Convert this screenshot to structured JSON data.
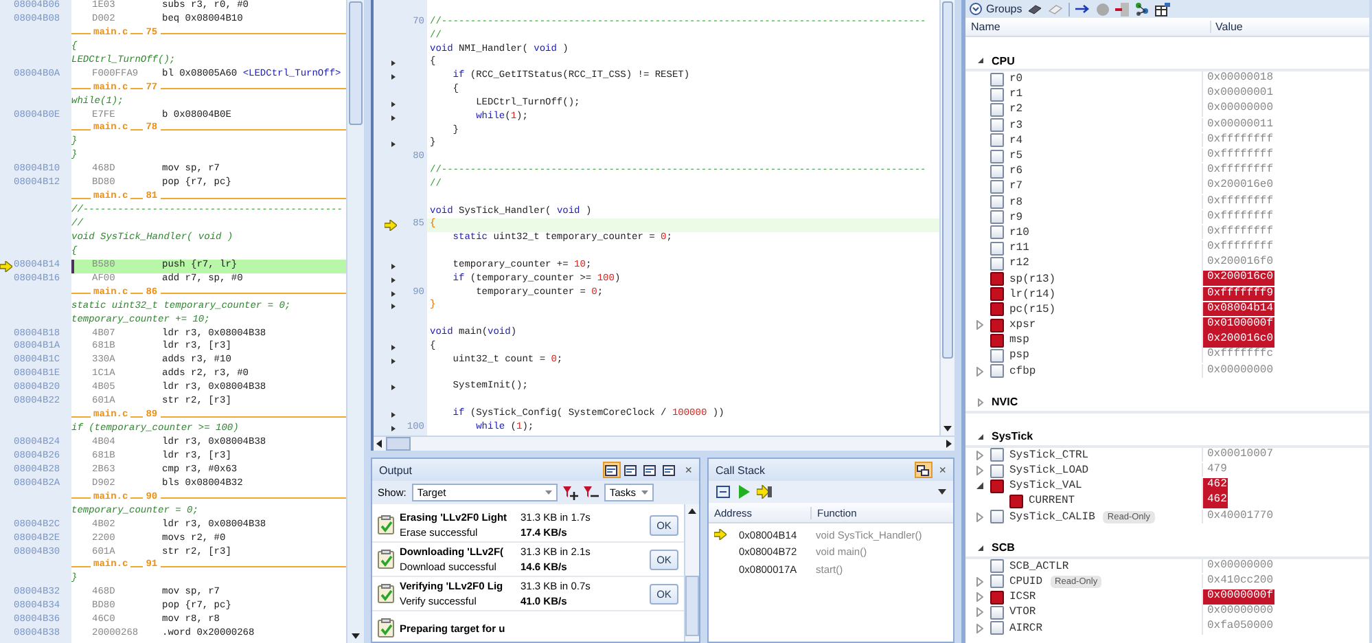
{
  "disassembly": {
    "lines": [
      {
        "kind": "asm",
        "address": "08004B06",
        "opcode": "1E03",
        "instruction": "subs r3, r0, #0",
        "current": false
      },
      {
        "kind": "asm",
        "address": "08004B08",
        "opcode": "D002",
        "instruction": "beq 0x08004B10",
        "current": false
      },
      {
        "kind": "file",
        "file": "main.c",
        "line": "75"
      },
      {
        "kind": "src",
        "text": "{"
      },
      {
        "kind": "src",
        "text": "LEDCtrl_TurnOff();"
      },
      {
        "kind": "asm",
        "address": "08004B0A",
        "opcode": "F000FFA9",
        "instruction": "bl 0x08005A60 ",
        "symbol": "<LEDCtrl_TurnOff>",
        "current": false
      },
      {
        "kind": "file",
        "file": "main.c",
        "line": "77"
      },
      {
        "kind": "src",
        "text": "while(1);"
      },
      {
        "kind": "asm",
        "address": "08004B0E",
        "opcode": "E7FE",
        "instruction": "b 0x08004B0E",
        "current": false
      },
      {
        "kind": "file",
        "file": "main.c",
        "line": "78"
      },
      {
        "kind": "src",
        "text": "}"
      },
      {
        "kind": "src",
        "text": "}"
      },
      {
        "kind": "asm",
        "address": "08004B10",
        "opcode": "468D",
        "instruction": "mov sp, r7",
        "current": false
      },
      {
        "kind": "asm",
        "address": "08004B12",
        "opcode": "BD80",
        "instruction": "pop {r7, pc}",
        "current": false
      },
      {
        "kind": "file",
        "file": "main.c",
        "line": "81"
      },
      {
        "kind": "src",
        "text": "//---------------------------------------------"
      },
      {
        "kind": "src",
        "text": "//"
      },
      {
        "kind": "src",
        "text": "void SysTick_Handler( void )"
      },
      {
        "kind": "src",
        "text": "{"
      },
      {
        "kind": "asm",
        "address": "08004B14",
        "opcode": "B580",
        "instruction": "push {r7, lr}",
        "current": true
      },
      {
        "kind": "asm",
        "address": "08004B16",
        "opcode": "AF00",
        "instruction": "add r7, sp, #0",
        "current": false
      },
      {
        "kind": "file",
        "file": "main.c",
        "line": "86"
      },
      {
        "kind": "src",
        "text": "static uint32_t temporary_counter = 0;"
      },
      {
        "kind": "src",
        "text": "temporary_counter += 10;"
      },
      {
        "kind": "asm",
        "address": "08004B18",
        "opcode": "4B07",
        "instruction": "ldr r3, 0x08004B38",
        "current": false
      },
      {
        "kind": "asm",
        "address": "08004B1A",
        "opcode": "681B",
        "instruction": "ldr r3, [r3]",
        "current": false
      },
      {
        "kind": "asm",
        "address": "08004B1C",
        "opcode": "330A",
        "instruction": "adds r3, #10",
        "current": false
      },
      {
        "kind": "asm",
        "address": "08004B1E",
        "opcode": "1C1A",
        "instruction": "adds r2, r3, #0",
        "current": false
      },
      {
        "kind": "asm",
        "address": "08004B20",
        "opcode": "4B05",
        "instruction": "ldr r3, 0x08004B38",
        "current": false
      },
      {
        "kind": "asm",
        "address": "08004B22",
        "opcode": "601A",
        "instruction": "str r2, [r3]",
        "current": false
      },
      {
        "kind": "file",
        "file": "main.c",
        "line": "89"
      },
      {
        "kind": "src",
        "text": "if (temporary_counter >= 100)"
      },
      {
        "kind": "asm",
        "address": "08004B24",
        "opcode": "4B04",
        "instruction": "ldr r3, 0x08004B38",
        "current": false
      },
      {
        "kind": "asm",
        "address": "08004B26",
        "opcode": "681B",
        "instruction": "ldr r3, [r3]",
        "current": false
      },
      {
        "kind": "asm",
        "address": "08004B28",
        "opcode": "2B63",
        "instruction": "cmp r3, #0x63",
        "current": false
      },
      {
        "kind": "asm",
        "address": "08004B2A",
        "opcode": "D902",
        "instruction": "bls 0x08004B32",
        "current": false
      },
      {
        "kind": "file",
        "file": "main.c",
        "line": "90"
      },
      {
        "kind": "src",
        "text": "temporary_counter = 0;"
      },
      {
        "kind": "asm",
        "address": "08004B2C",
        "opcode": "4B02",
        "instruction": "ldr r3, 0x08004B38",
        "current": false
      },
      {
        "kind": "asm",
        "address": "08004B2E",
        "opcode": "2200",
        "instruction": "movs r2, #0",
        "current": false
      },
      {
        "kind": "asm",
        "address": "08004B30",
        "opcode": "601A",
        "instruction": "str r2, [r3]",
        "current": false
      },
      {
        "kind": "file",
        "file": "main.c",
        "line": "91"
      },
      {
        "kind": "src",
        "text": "}"
      },
      {
        "kind": "asm",
        "address": "08004B32",
        "opcode": "468D",
        "instruction": "mov sp, r7",
        "current": false
      },
      {
        "kind": "asm",
        "address": "08004B34",
        "opcode": "BD80",
        "instruction": "pop {r7, pc}",
        "current": false
      },
      {
        "kind": "asm",
        "address": "08004B36",
        "opcode": "46C0",
        "instruction": "mov r8, r8",
        "current": false
      },
      {
        "kind": "asm",
        "address": "08004B38",
        "opcode": "20000268",
        "instruction": ".word 0x20000268",
        "current": false
      }
    ]
  },
  "editor": {
    "lines": [
      {
        "number": "70",
        "marker": false,
        "current": false,
        "tokens": [
          {
            "t": "//------------------------------------------------------------------------------------",
            "kind": "comment"
          }
        ]
      },
      {
        "marker": false,
        "current": false,
        "tokens": [
          {
            "t": "//",
            "kind": "comment"
          }
        ]
      },
      {
        "marker": false,
        "current": false,
        "tokens": [
          {
            "t": "void",
            "kind": "kw"
          },
          {
            "t": " NMI_Handler( ",
            "kind": "tx"
          },
          {
            "t": "void",
            "kind": "kw"
          },
          {
            "t": " )",
            "kind": "tx"
          }
        ]
      },
      {
        "marker": true,
        "current": false,
        "tokens": [
          {
            "t": "{",
            "kind": "tx"
          }
        ]
      },
      {
        "marker": true,
        "current": false,
        "tokens": [
          {
            "t": "    if",
            "kind": "kw"
          },
          {
            "t": " (RCC_GetITStatus(RCC_IT_CSS) != RESET)",
            "kind": "tx"
          }
        ]
      },
      {
        "marker": false,
        "current": false,
        "tokens": [
          {
            "t": "    {",
            "kind": "tx"
          }
        ]
      },
      {
        "marker": true,
        "current": false,
        "tokens": [
          {
            "t": "        LEDCtrl_TurnOff();",
            "kind": "tx"
          }
        ]
      },
      {
        "marker": true,
        "current": false,
        "tokens": [
          {
            "t": "        while",
            "kind": "kw"
          },
          {
            "t": "(",
            "kind": "tx"
          },
          {
            "t": "1",
            "kind": "num"
          },
          {
            "t": ");",
            "kind": "tx"
          }
        ]
      },
      {
        "marker": false,
        "current": false,
        "tokens": [
          {
            "t": "    }",
            "kind": "tx"
          }
        ]
      },
      {
        "marker": true,
        "current": false,
        "tokens": [
          {
            "t": "}",
            "kind": "tx"
          }
        ]
      },
      {
        "number": "80",
        "marker": false,
        "current": false
      },
      {
        "marker": false,
        "current": false,
        "tokens": [
          {
            "t": "//------------------------------------------------------------------------------------",
            "kind": "comment"
          }
        ]
      },
      {
        "marker": false,
        "current": false,
        "tokens": [
          {
            "t": "//",
            "kind": "comment"
          }
        ]
      },
      {
        "marker": false,
        "current": false
      },
      {
        "marker": false,
        "current": false,
        "tokens": [
          {
            "t": "void",
            "kind": "kw"
          },
          {
            "t": " SysTick_Handler( ",
            "kind": "tx"
          },
          {
            "t": "void",
            "kind": "kw"
          },
          {
            "t": " )",
            "kind": "tx"
          }
        ]
      },
      {
        "number": "85",
        "marker": false,
        "current": true,
        "tokens": [
          {
            "t": "{",
            "kind": "match"
          }
        ]
      },
      {
        "marker": false,
        "current": false,
        "tokens": [
          {
            "t": "    static",
            "kind": "kw"
          },
          {
            "t": " uint32_t temporary_counter = ",
            "kind": "tx"
          },
          {
            "t": "0",
            "kind": "num"
          },
          {
            "t": ";",
            "kind": "tx"
          }
        ]
      },
      {
        "marker": false,
        "current": false
      },
      {
        "marker": true,
        "current": false,
        "tokens": [
          {
            "t": "    temporary_counter += ",
            "kind": "tx"
          },
          {
            "t": "10",
            "kind": "num"
          },
          {
            "t": ";",
            "kind": "tx"
          }
        ]
      },
      {
        "marker": true,
        "current": false,
        "tokens": [
          {
            "t": "    if",
            "kind": "kw"
          },
          {
            "t": " (temporary_counter >= ",
            "kind": "tx"
          },
          {
            "t": "100",
            "kind": "num"
          },
          {
            "t": ")",
            "kind": "tx"
          }
        ]
      },
      {
        "number": "90",
        "marker": true,
        "current": false,
        "tokens": [
          {
            "t": "        temporary_counter = ",
            "kind": "tx"
          },
          {
            "t": "0",
            "kind": "num"
          },
          {
            "t": ";",
            "kind": "tx"
          }
        ]
      },
      {
        "marker": true,
        "current": false,
        "tokens": [
          {
            "t": "}",
            "kind": "match"
          }
        ]
      },
      {
        "marker": false,
        "current": false
      },
      {
        "marker": false,
        "current": false,
        "tokens": [
          {
            "t": "void",
            "kind": "kw"
          },
          {
            "t": " main(",
            "kind": "tx"
          },
          {
            "t": "void",
            "kind": "kw"
          },
          {
            "t": ")",
            "kind": "tx"
          }
        ]
      },
      {
        "marker": true,
        "current": false,
        "tokens": [
          {
            "t": "{",
            "kind": "tx"
          }
        ]
      },
      {
        "marker": true,
        "current": false,
        "tokens": [
          {
            "t": "    uint32_t count = ",
            "kind": "tx"
          },
          {
            "t": "0",
            "kind": "num"
          },
          {
            "t": ";",
            "kind": "tx"
          }
        ]
      },
      {
        "marker": false,
        "current": false
      },
      {
        "marker": true,
        "current": false,
        "tokens": [
          {
            "t": "    SystemInit();",
            "kind": "tx"
          }
        ]
      },
      {
        "marker": false,
        "current": false
      },
      {
        "marker": true,
        "current": false,
        "tokens": [
          {
            "t": "    if",
            "kind": "kw"
          },
          {
            "t": " (SysTick_Config( SystemCoreClock / ",
            "kind": "tx"
          },
          {
            "t": "100000",
            "kind": "num"
          },
          {
            "t": " ))",
            "kind": "tx"
          }
        ]
      },
      {
        "number": "100",
        "marker": true,
        "current": false,
        "tokens": [
          {
            "t": "        while",
            "kind": "kw"
          },
          {
            "t": " (",
            "kind": "tx"
          },
          {
            "t": "1",
            "kind": "num"
          },
          {
            "t": ");",
            "kind": "tx"
          }
        ]
      }
    ]
  },
  "output": {
    "title": "Output",
    "close": "×",
    "view_buttons": [
      {
        "selected": true
      },
      {
        "selected": false
      },
      {
        "selected": false
      },
      {
        "selected": false
      }
    ],
    "show_label": "Show:",
    "show_value": "Target",
    "tasks_value": "Tasks",
    "tasks": [
      {
        "title": "Erasing 'LLv2F0 Light",
        "status": "Erase successful",
        "size": "31.3 KB in 1.7s",
        "speed": "17.4 KB/s",
        "button": "OK"
      },
      {
        "title": "Downloading 'LLv2F(",
        "status": "Download successful",
        "size": "31.3 KB in 2.1s",
        "speed": "14.6 KB/s",
        "button": "OK"
      },
      {
        "title": "Verifying 'LLv2F0 Lig",
        "status": "Verify successful",
        "size": "31.3 KB in 0.7s",
        "speed": "41.0 KB/s",
        "button": "OK"
      },
      {
        "title": "Preparing target for u"
      }
    ]
  },
  "call_stack": {
    "title": "Call Stack",
    "close": "×",
    "sync_selected": true,
    "columns": [
      "Address",
      "Function"
    ],
    "rows": [
      {
        "address": "0x08004B14",
        "function": "void SysTick_Handler()",
        "current": true
      },
      {
        "address": "0x08004B72",
        "function": "void main()",
        "current": false
      },
      {
        "address": "0x0800017A",
        "function": "start()",
        "current": false
      }
    ]
  },
  "registers": {
    "toolbar_label": "Groups",
    "columns": [
      "Name",
      "Value"
    ],
    "groups": [
      {
        "name": "CPU",
        "expanded": true,
        "rows": [
          {
            "name": "r0",
            "value": "0x00000018",
            "changed": false,
            "expandable": false,
            "expanded": false
          },
          {
            "name": "r1",
            "value": "0x00000001",
            "changed": false,
            "expandable": false,
            "expanded": false
          },
          {
            "name": "r2",
            "value": "0x00000000",
            "changed": false,
            "expandable": false,
            "expanded": false
          },
          {
            "name": "r3",
            "value": "0x00000011",
            "changed": false,
            "expandable": false,
            "expanded": false
          },
          {
            "name": "r4",
            "value": "0xffffffff",
            "changed": false,
            "expandable": false,
            "expanded": false
          },
          {
            "name": "r5",
            "value": "0xffffffff",
            "changed": false,
            "expandable": false,
            "expanded": false
          },
          {
            "name": "r6",
            "value": "0xffffffff",
            "changed": false,
            "expandable": false,
            "expanded": false
          },
          {
            "name": "r7",
            "value": "0x200016e0",
            "changed": false,
            "expandable": false,
            "expanded": false
          },
          {
            "name": "r8",
            "value": "0xffffffff",
            "changed": false,
            "expandable": false,
            "expanded": false
          },
          {
            "name": "r9",
            "value": "0xffffffff",
            "changed": false,
            "expandable": false,
            "expanded": false
          },
          {
            "name": "r10",
            "value": "0xffffffff",
            "changed": false,
            "expandable": false,
            "expanded": false
          },
          {
            "name": "r11",
            "value": "0xffffffff",
            "changed": false,
            "expandable": false,
            "expanded": false
          },
          {
            "name": "r12",
            "value": "0x200016f0",
            "changed": false,
            "expandable": false,
            "expanded": false
          },
          {
            "name": "sp(r13)",
            "value": "0x200016c0",
            "changed": true,
            "expandable": false,
            "expanded": false
          },
          {
            "name": "lr(r14)",
            "value": "0xfffffff9",
            "changed": true,
            "expandable": false,
            "expanded": false
          },
          {
            "name": "pc(r15)",
            "value": "0x08004b14",
            "changed": true,
            "expandable": false,
            "expanded": false
          },
          {
            "name": "xpsr",
            "value": "0x0100000f",
            "changed": true,
            "expandable": true,
            "expanded": false
          },
          {
            "name": "msp",
            "value": "0x200016c0",
            "changed": true,
            "expandable": false,
            "expanded": false
          },
          {
            "name": "psp",
            "value": "0xfffffffc",
            "changed": false,
            "expandable": false,
            "expanded": false
          },
          {
            "name": "cfbp",
            "value": "0x00000000",
            "changed": false,
            "expandable": true,
            "expanded": false
          }
        ]
      },
      {
        "name": "NVIC",
        "expanded": false
      },
      {
        "name": "SysTick",
        "expanded": true,
        "rows": [
          {
            "name": "SysTick_CTRL",
            "value": "0x00010007",
            "changed": false,
            "expandable": true,
            "expanded": false
          },
          {
            "name": "SysTick_LOAD",
            "value": "479",
            "changed": false,
            "expandable": true,
            "expanded": false
          },
          {
            "name": "SysTick_VAL",
            "value": "462",
            "changed": true,
            "expanded": true,
            "children": [
              {
                "name": "CURRENT",
                "value": "462",
                "changed": true,
                "expandable": false,
                "expanded": false
              }
            ]
          },
          {
            "name": "SysTick_CALIB",
            "badge": "Read-Only",
            "value": "0x40001770",
            "changed": false,
            "expandable": true,
            "expanded": false
          }
        ]
      },
      {
        "name": "SCB",
        "expanded": true,
        "rows": [
          {
            "name": "SCB_ACTLR",
            "value": "0x00000000",
            "changed": false,
            "expandable": false,
            "expanded": false
          },
          {
            "name": "CPUID",
            "badge": "Read-Only",
            "value": "0x410cc200",
            "changed": false,
            "expandable": true,
            "expanded": false
          },
          {
            "name": "ICSR",
            "value": "0x0000000f",
            "changed": true,
            "expandable": true,
            "expanded": false
          },
          {
            "name": "VTOR",
            "value": "0x00000000",
            "changed": false,
            "expandable": true,
            "expanded": false
          },
          {
            "name": "AIRCR",
            "value": "0xfa050000",
            "changed": false,
            "expandable": true,
            "expanded": false
          }
        ]
      }
    ]
  }
}
